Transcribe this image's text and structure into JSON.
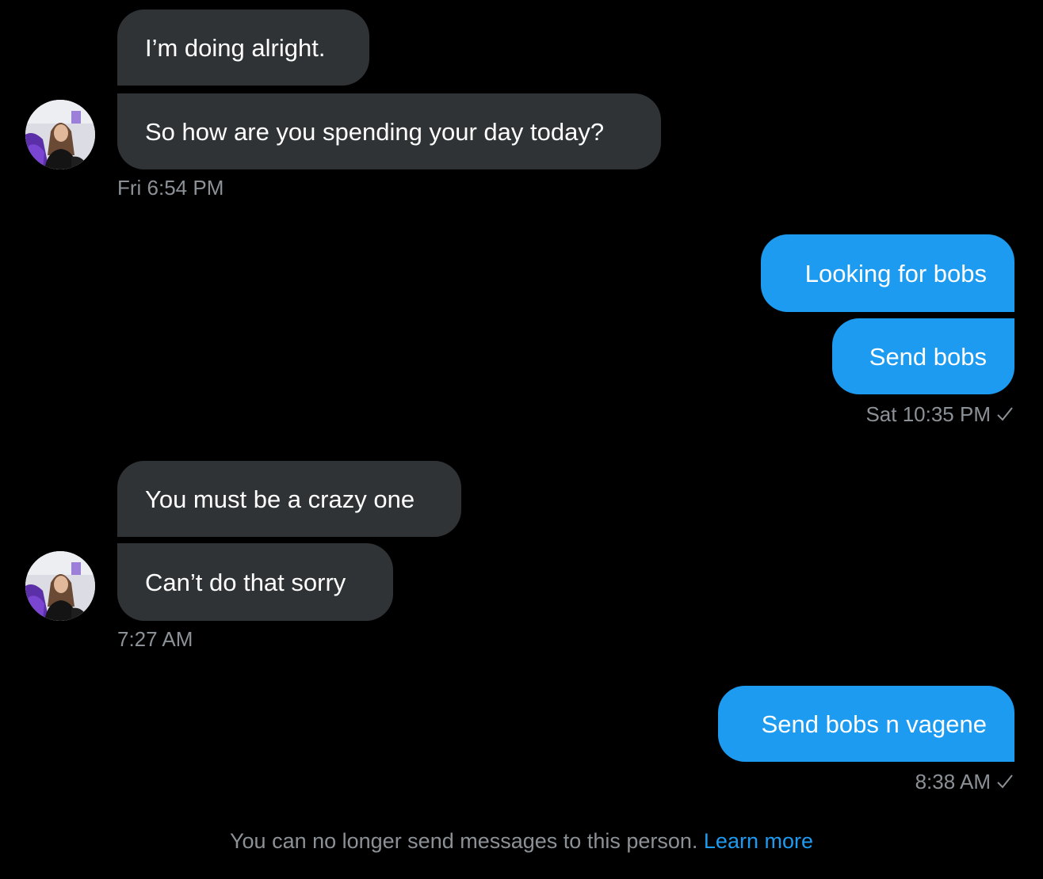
{
  "conversation": {
    "groups": [
      {
        "sender": "them",
        "messages": [
          "I’m doing alright.",
          "So how are you spending your day today?"
        ],
        "timestamp": "Fri 6:54 PM"
      },
      {
        "sender": "me",
        "messages": [
          "Looking for bobs",
          "Send bobs"
        ],
        "timestamp": "Sat 10:35 PM",
        "status_icon": "check-icon"
      },
      {
        "sender": "them",
        "messages": [
          "You must be a crazy one",
          "Can’t do that sorry"
        ],
        "timestamp": "7:27 AM"
      },
      {
        "sender": "me",
        "messages": [
          "Send bobs n vagene"
        ],
        "timestamp": "8:38 AM",
        "status_icon": "check-icon"
      }
    ]
  },
  "footer": {
    "notice": "You can no longer send messages to this person.",
    "link": "Learn more"
  },
  "colors": {
    "background": "#000000",
    "incoming_bubble": "#2f3336",
    "outgoing_bubble": "#1d9bf0",
    "timestamp": "#8b9196",
    "link": "#1d9bf0"
  }
}
